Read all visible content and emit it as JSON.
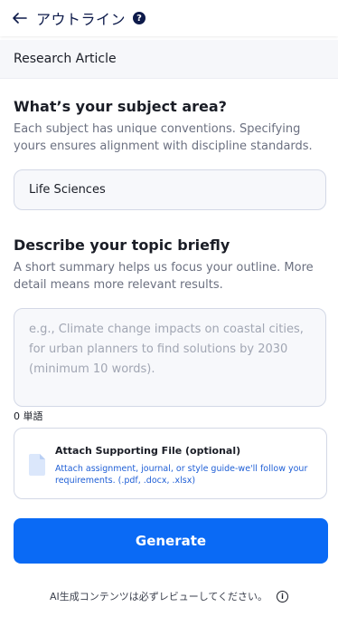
{
  "header": {
    "title": "アウトライン",
    "help_glyph": "?"
  },
  "doc_type": {
    "label": "Research Article"
  },
  "subject": {
    "heading": "What’s your subject area?",
    "description": "Each subject has unique conventions. Specifying yours ensures alignment with discipline standards.",
    "value": "Life Sciences"
  },
  "topic": {
    "heading": "Describe your topic briefly",
    "description": "A short summary helps us focus your outline. More detail means more relevant results.",
    "placeholder": "e.g., Climate change impacts on coastal cities, for urban planners to find solutions by 2030 (minimum 10 words).",
    "value": "",
    "word_count": "0 単語"
  },
  "attachment": {
    "title": "Attach Supporting File (optional)",
    "description": "Attach assignment, journal, or style guide-we'll follow your requirements. (.pdf, .docx, .xlsx)"
  },
  "generate_button": {
    "label": "Generate"
  },
  "footer": {
    "note": "AI生成コンテンツは必ずレビューしてください。",
    "info_glyph": "i"
  },
  "colors": {
    "primary": "#0a6af5",
    "heading_navy": "#0d1a4a",
    "link_blue": "#1f5fd6",
    "panel_bg": "#f6f7fa",
    "field_bg": "#f7f8fb",
    "border": "#d3d8e6"
  },
  "icons": {
    "back": "arrow-left-icon",
    "help": "question-circle-icon",
    "file": "file-icon",
    "info": "info-circle-icon"
  }
}
